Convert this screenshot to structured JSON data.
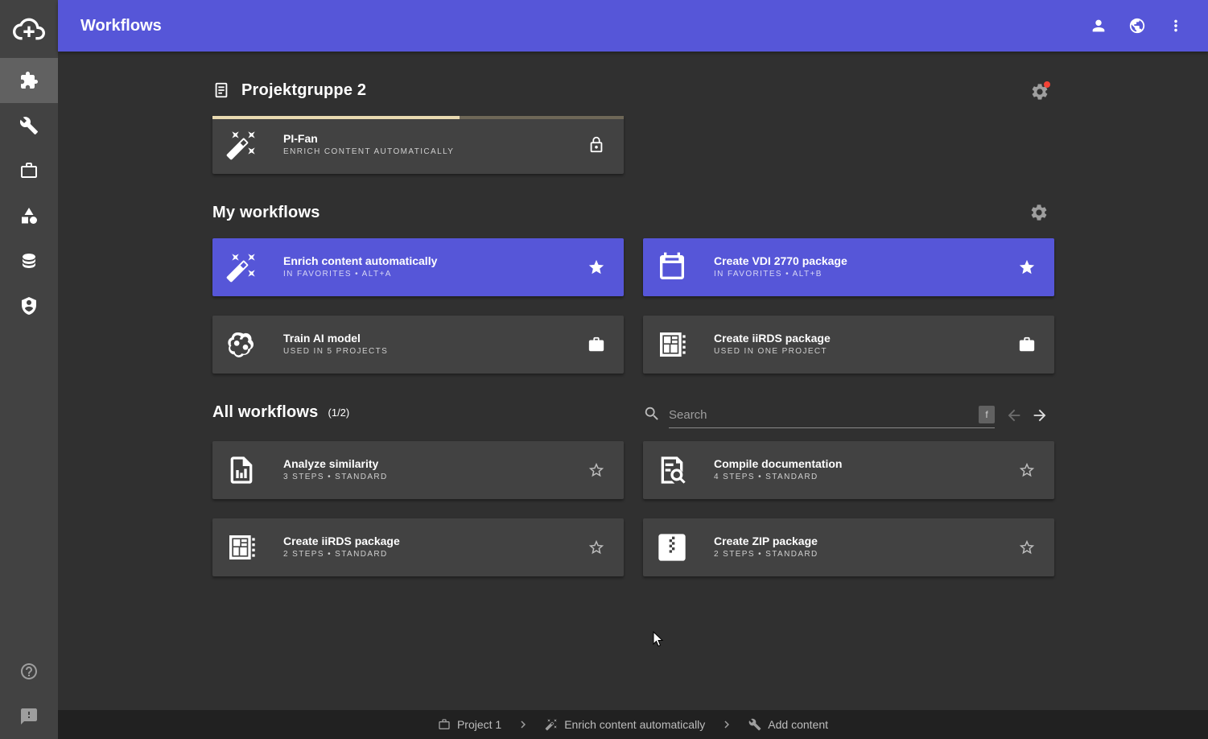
{
  "header": {
    "title": "Workflows"
  },
  "group": {
    "title": "Projektgruppe 2",
    "card": {
      "title": "PI-Fan",
      "subtitle": "ENRICH CONTENT AUTOMATICALLY",
      "progress": 0.6
    }
  },
  "my_workflows": {
    "title": "My workflows",
    "cards": [
      {
        "title": "Enrich content automatically",
        "subtitle": "IN FAVORITES • ALT+A",
        "icon": "magic-wand-icon",
        "action": "star-filled-icon"
      },
      {
        "title": "Create VDI 2770 package",
        "subtitle": "IN FAVORITES • ALT+B",
        "icon": "calendar-icon",
        "action": "star-filled-icon"
      },
      {
        "title": "Train AI model",
        "subtitle": "USED IN 5 PROJECTS",
        "icon": "brain-icon",
        "action": "briefcase-icon"
      },
      {
        "title": "Create iiRDS package",
        "subtitle": "USED IN ONE PROJECT",
        "icon": "package-icon",
        "action": "briefcase-icon"
      }
    ]
  },
  "all_workflows": {
    "title": "All workflows",
    "count": "(1/2)",
    "search_placeholder": "Search",
    "shortcut": "f",
    "cards": [
      {
        "title": "Analyze similarity",
        "subtitle": "3 STEPS • STANDARD",
        "icon": "chart-document-icon"
      },
      {
        "title": "Compile documentation",
        "subtitle": "4 STEPS • STANDARD",
        "icon": "document-search-icon"
      },
      {
        "title": "Create iiRDS package",
        "subtitle": "2 STEPS • STANDARD",
        "icon": "package-icon"
      },
      {
        "title": "Create ZIP package",
        "subtitle": "2 STEPS • STANDARD",
        "icon": "zip-icon"
      }
    ]
  },
  "footer": {
    "crumbs": [
      "Project 1",
      "Enrich content automatically",
      "Add content"
    ]
  },
  "colors": {
    "primary": "#5656d8",
    "background": "#303030",
    "card": "#424242",
    "sidebar": "#424242",
    "badge": "#f44336"
  }
}
